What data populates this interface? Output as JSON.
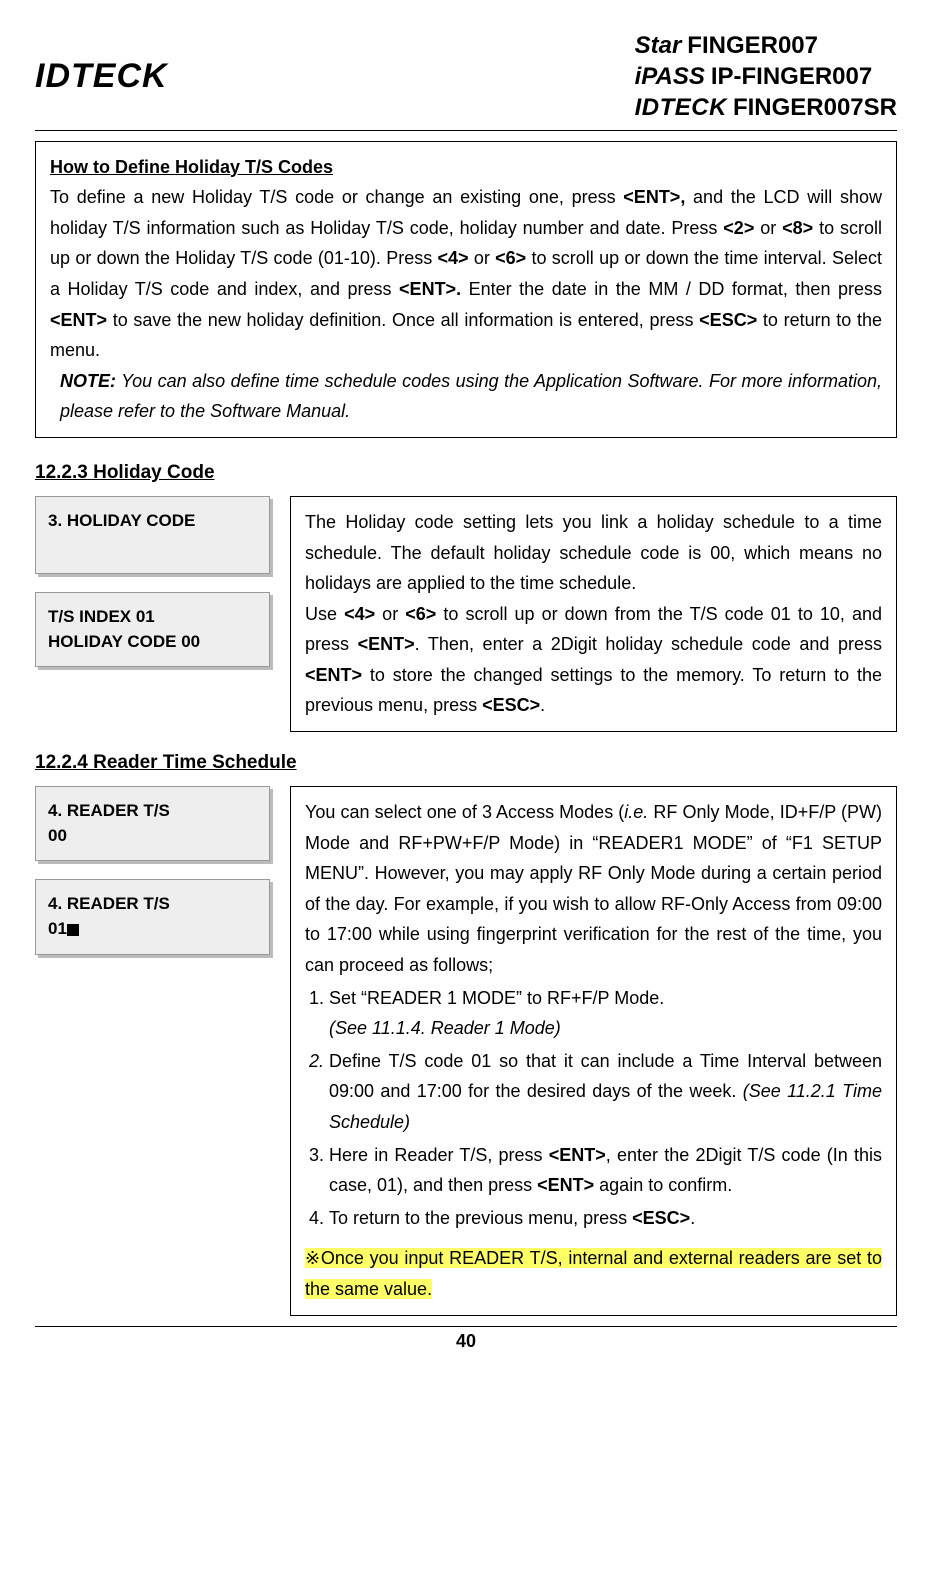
{
  "header": {
    "logo_left": "IDTECK",
    "logo_rows": [
      {
        "brand": "Star",
        "model": "FINGER007"
      },
      {
        "brand": "iPASS",
        "model": "IP-FINGER007"
      },
      {
        "brand": "IDTECK",
        "model": "FINGER007SR"
      }
    ]
  },
  "define_box": {
    "title": "How to Define Holiday T/S Codes",
    "p1a": "To define a new Holiday T/S code or change an existing one, press ",
    "k1": "<ENT>,",
    "p1b": " and the LCD will show holiday T/S information such as Holiday T/S code, holiday number and date. Press ",
    "k2": "<2>",
    "p1c": " or ",
    "k3": "<8>",
    "p1d": " to scroll up or down the Holiday T/S code (01-10). Press ",
    "k4": "<4>",
    "p1e": " or ",
    "k5": "<6>",
    "p1f": " to scroll up or down the time interval. Select a Holiday T/S code and index, and press ",
    "k6": "<ENT>.",
    "p1g": " Enter the date in the MM / DD format, then press ",
    "k7": "<ENT>",
    "p1h": " to save the new holiday definition. Once all information is entered, press ",
    "k8": "<ESC>",
    "p1i": " to return to the menu.",
    "note_label": "NOTE:",
    "note_body": " You can also define time schedule codes using the Application Software. For more information, please refer to the Software Manual."
  },
  "sec_hc": {
    "title": "12.2.3 Holiday Code",
    "lcd1": "3. HOLIDAY CODE",
    "lcd2_l1": "T/S INDEX        01",
    "lcd2_l2": "HOLIDAY CODE 00",
    "p1": "The Holiday code setting lets you link a holiday schedule to a time schedule. The default holiday schedule code is 00, which means no holidays are applied to the time schedule.",
    "p2a": "Use ",
    "k4": "<4>",
    "p2b": " or ",
    "k6": "<6>",
    "p2c": " to scroll up or down from the T/S code 01 to 10, and press ",
    "kent": "<ENT>",
    "p2d": ". Then, enter a 2Digit holiday schedule code and press ",
    "kent2": "<ENT>",
    "p2e": " to store the changed settings to the memory. To return to the previous menu, press ",
    "kesc": "<ESC>",
    "p2f": "."
  },
  "sec_rts": {
    "title": "12.2.4 Reader Time Schedule",
    "lcd1_l1": "4. READER T/S",
    "lcd1_l2": " 00",
    "lcd2_l1": "4. READER T/S",
    "lcd2_l2": "01",
    "intro_a": "You can select one of 3 Access Modes (",
    "intro_ie": "i.e.",
    "intro_b": " RF Only Mode, ID+F/P (PW) Mode and RF+PW+F/P Mode) in “READER1 MODE” of “F1 SETUP MENU”. However, you may apply RF Only Mode during a certain period of the day. For example, if you wish to allow RF-Only Access from 09:00 to 17:00 while using fingerprint verification for the rest of the time, you can proceed as follows;",
    "li1_a": "Set “READER 1 MODE” to RF+F/P Mode.",
    "li1_b": "(See 11.1.4. Reader 1 Mode)",
    "li2_a": "Define T/S code 01 so that it can include a Time Interval between 09:00 and 17:00 for the desired days of the week. ",
    "li2_b": "(See 11.2.1 Time Schedule)",
    "li3_a": "Here in Reader T/S, press ",
    "li3_k1": "<ENT>",
    "li3_b": ", enter the 2Digit T/S code (In this case, 01), and then press ",
    "li3_k2": "<ENT>",
    "li3_c": " again to confirm.",
    "li4_a": "To return to the previous menu, press ",
    "li4_k1": "<ESC>",
    "li4_b": ".",
    "hl": "※Once you input READER T/S, internal and external readers are set to the same value."
  },
  "footer": {
    "page": "40"
  }
}
